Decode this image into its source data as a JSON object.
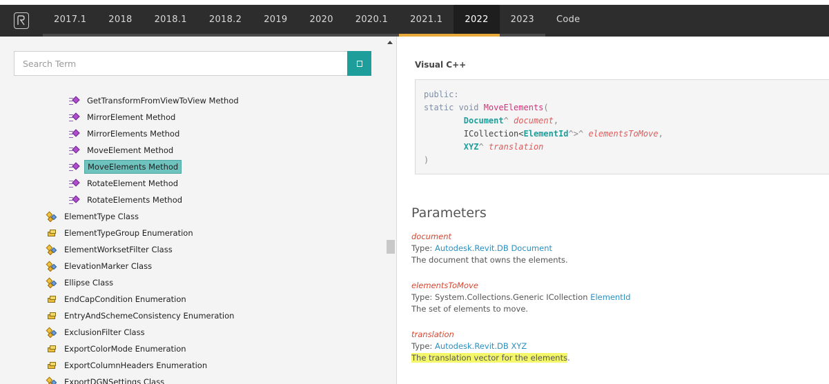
{
  "nav": {
    "tabs": [
      {
        "label": "2017.1"
      },
      {
        "label": "2018"
      },
      {
        "label": "2018.1"
      },
      {
        "label": "2018.2"
      },
      {
        "label": "2019"
      },
      {
        "label": "2020"
      },
      {
        "label": "2020.1"
      },
      {
        "label": "2021.1"
      },
      {
        "label": "2022"
      },
      {
        "label": "2023"
      },
      {
        "label": "Code"
      }
    ],
    "active_tab": "2022"
  },
  "search": {
    "placeholder": "Search Term",
    "value": ""
  },
  "tree": {
    "methods": [
      {
        "label": "GetTransformFromViewToView Method",
        "icon": "method-icon"
      },
      {
        "label": "MirrorElement Method",
        "icon": "method-icon"
      },
      {
        "label": "MirrorElements Method",
        "icon": "method-icon"
      },
      {
        "label": "MoveElement Method",
        "icon": "method-icon"
      },
      {
        "label": "MoveElements Method",
        "icon": "method-icon",
        "selected": true
      },
      {
        "label": "RotateElement Method",
        "icon": "method-icon"
      },
      {
        "label": "RotateElements Method",
        "icon": "method-icon"
      }
    ],
    "types": [
      {
        "label": "ElementType Class",
        "icon": "class-icon"
      },
      {
        "label": "ElementTypeGroup Enumeration",
        "icon": "enum-icon"
      },
      {
        "label": "ElementWorksetFilter Class",
        "icon": "class-icon"
      },
      {
        "label": "ElevationMarker Class",
        "icon": "class-icon"
      },
      {
        "label": "Ellipse Class",
        "icon": "class-icon"
      },
      {
        "label": "EndCapCondition Enumeration",
        "icon": "enum-icon"
      },
      {
        "label": "EntryAndSchemeConsistency Enumeration",
        "icon": "enum-icon"
      },
      {
        "label": "ExclusionFilter Class",
        "icon": "class-icon"
      },
      {
        "label": "ExportColorMode Enumeration",
        "icon": "enum-icon"
      },
      {
        "label": "ExportColumnHeaders Enumeration",
        "icon": "enum-icon"
      },
      {
        "label": "ExportDGNSettings Class",
        "icon": "class-icon"
      }
    ]
  },
  "content": {
    "language": "Visual C++",
    "code": {
      "l1": "public:",
      "l2_kw": "static void ",
      "l2_fn": "MoveElements",
      "l2_p": "(",
      "l3_ty": "Document",
      "l3_op": "^ ",
      "l3_pr": "document",
      "l3_c": ",",
      "l4_a": "ICollection<",
      "l4_ty": "ElementId",
      "l4_b": "^>^ ",
      "l4_pr": "elementsToMove",
      "l4_c": ",",
      "l5_ty": "XYZ",
      "l5_op": "^ ",
      "l5_pr": "translation",
      "l6": ")"
    },
    "parameters_title": "Parameters",
    "parameters": [
      {
        "name": "document",
        "type_prefix": "Type: ",
        "type_link": "Autodesk.Revit.DB Document",
        "type_extra": "",
        "description": "The document that owns the elements."
      },
      {
        "name": "elementsToMove",
        "type_prefix": "Type: System.Collections.Generic ICollection ",
        "type_link": "ElementId",
        "type_extra": "",
        "description": "The set of elements to move."
      },
      {
        "name": "translation",
        "type_prefix": "Type: ",
        "type_link": "Autodesk.Revit.DB XYZ",
        "type_extra": "",
        "description_highlighted": "The translation vector for the elements",
        "description_tail": "."
      }
    ]
  }
}
